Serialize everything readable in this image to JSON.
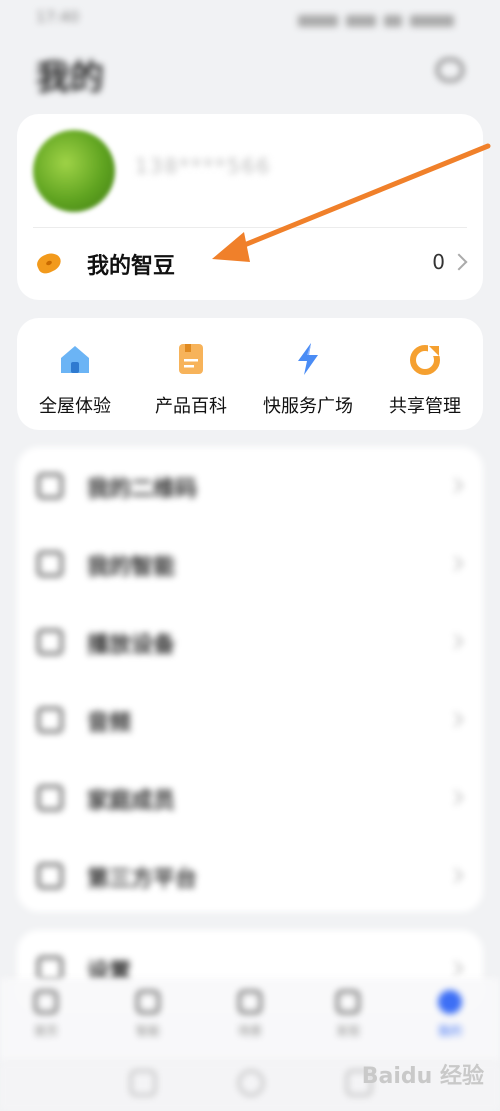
{
  "status_bar": {
    "time": "17:40"
  },
  "header": {
    "title": "我的"
  },
  "profile": {
    "username": "138****566",
    "bean_label": "我的智豆",
    "bean_count": "0"
  },
  "shortcuts": [
    {
      "label": "全屋体验",
      "icon": "house-icon",
      "color": "#5aa8f0"
    },
    {
      "label": "产品百科",
      "icon": "book-icon",
      "color": "#f5a84a"
    },
    {
      "label": "快服务广场",
      "icon": "lightning-icon",
      "color": "#4a8cf5"
    },
    {
      "label": "共享管理",
      "icon": "share-icon",
      "color": "#f5a030"
    }
  ],
  "menu": [
    {
      "label": "我的二维码",
      "icon": "qrcode-icon"
    },
    {
      "label": "我的智能",
      "icon": "device-icon"
    },
    {
      "label": "播放设备",
      "icon": "speaker-icon"
    },
    {
      "label": "音频",
      "icon": "music-icon"
    },
    {
      "label": "家庭成员",
      "icon": "person-icon"
    },
    {
      "label": "第三方平台",
      "icon": "platform-icon"
    }
  ],
  "menu2": [
    {
      "label": "设置",
      "icon": "settings-icon"
    }
  ],
  "tabs": [
    {
      "label": "首页",
      "active": false
    },
    {
      "label": "智能",
      "active": false
    },
    {
      "label": "场景",
      "active": false
    },
    {
      "label": "发现",
      "active": false
    },
    {
      "label": "我的",
      "active": true
    }
  ],
  "watermark": "Baidu 经验",
  "colors": {
    "accent": "#3d6ff5",
    "annotation_arrow": "#f0802a",
    "bean": "#f29a1c",
    "background": "#f1f2f4"
  }
}
